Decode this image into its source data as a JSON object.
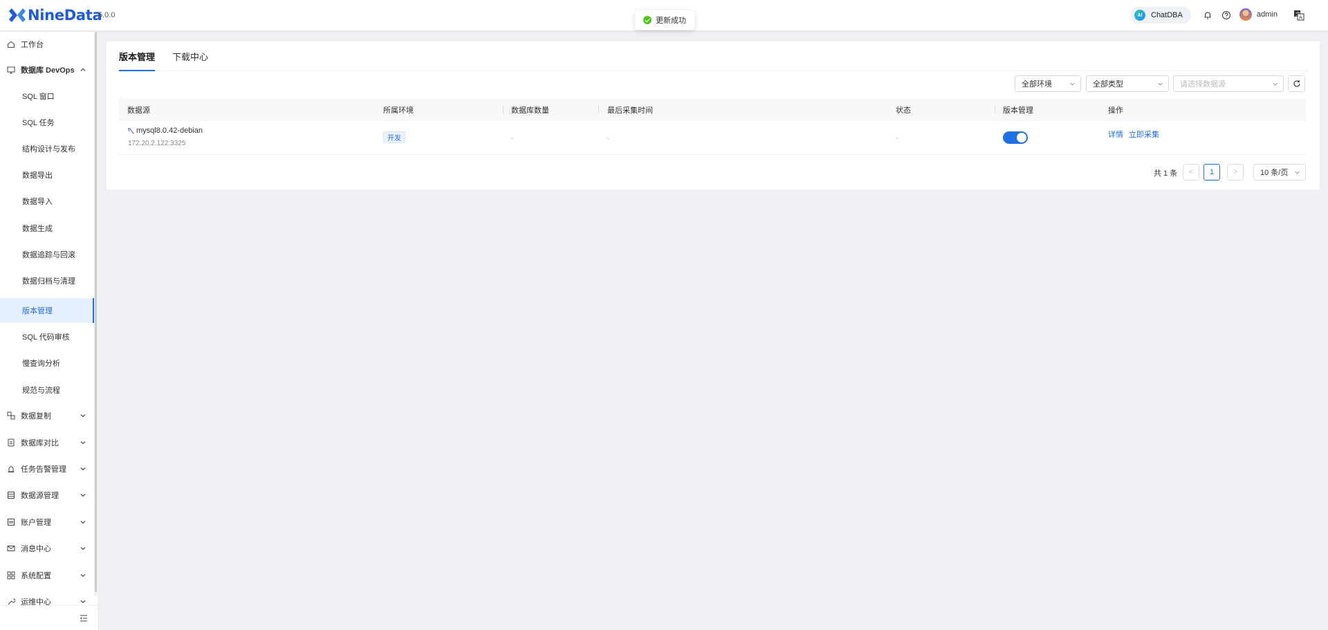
{
  "header": {
    "logo_text": "NineData",
    "version": "5.0.0",
    "toast": "更新成功",
    "chatdba_label": "ChatDBA",
    "ai_badge": "AI",
    "user_name": "admin"
  },
  "sidebar": {
    "workbench": "工作台",
    "devops": "数据库 DevOps",
    "devops_items": [
      "SQL 窗口",
      "SQL 任务",
      "结构设计与发布",
      "数据导出",
      "数据导入",
      "数据生成",
      "数据追踪与回滚",
      "数据归档与清理",
      "版本管理",
      "SQL 代码审核",
      "慢查询分析",
      "规范与流程"
    ],
    "groups": [
      "数据复制",
      "数据库对比",
      "任务告警管理",
      "数据源管理",
      "账户管理",
      "消息中心",
      "系统配置",
      "运维中心"
    ]
  },
  "tabs": [
    "版本管理",
    "下载中心"
  ],
  "filters": {
    "env": "全部环境",
    "type": "全部类型",
    "datasource_placeholder": "请选择数据源"
  },
  "table": {
    "columns": [
      "数据源",
      "所属环境",
      "数据库数量",
      "最后采集时间",
      "状态",
      "版本管理",
      "操作"
    ],
    "rows": [
      {
        "name": "mysql8.0.42-debian",
        "ip": "172.20.2.122:3325",
        "env": "开发",
        "db_count": "-",
        "last_time": "-",
        "status": "-",
        "version_enabled": true,
        "action_detail": "详情",
        "action_collect": "立即采集"
      }
    ]
  },
  "pagination": {
    "total": "共 1 条",
    "current": "1",
    "prev": "<",
    "next": ">",
    "page_size": "10 条/页"
  },
  "colors": {
    "accent": "#1f6fe5",
    "logo": "#1f5bd8",
    "success": "#52c41a"
  }
}
